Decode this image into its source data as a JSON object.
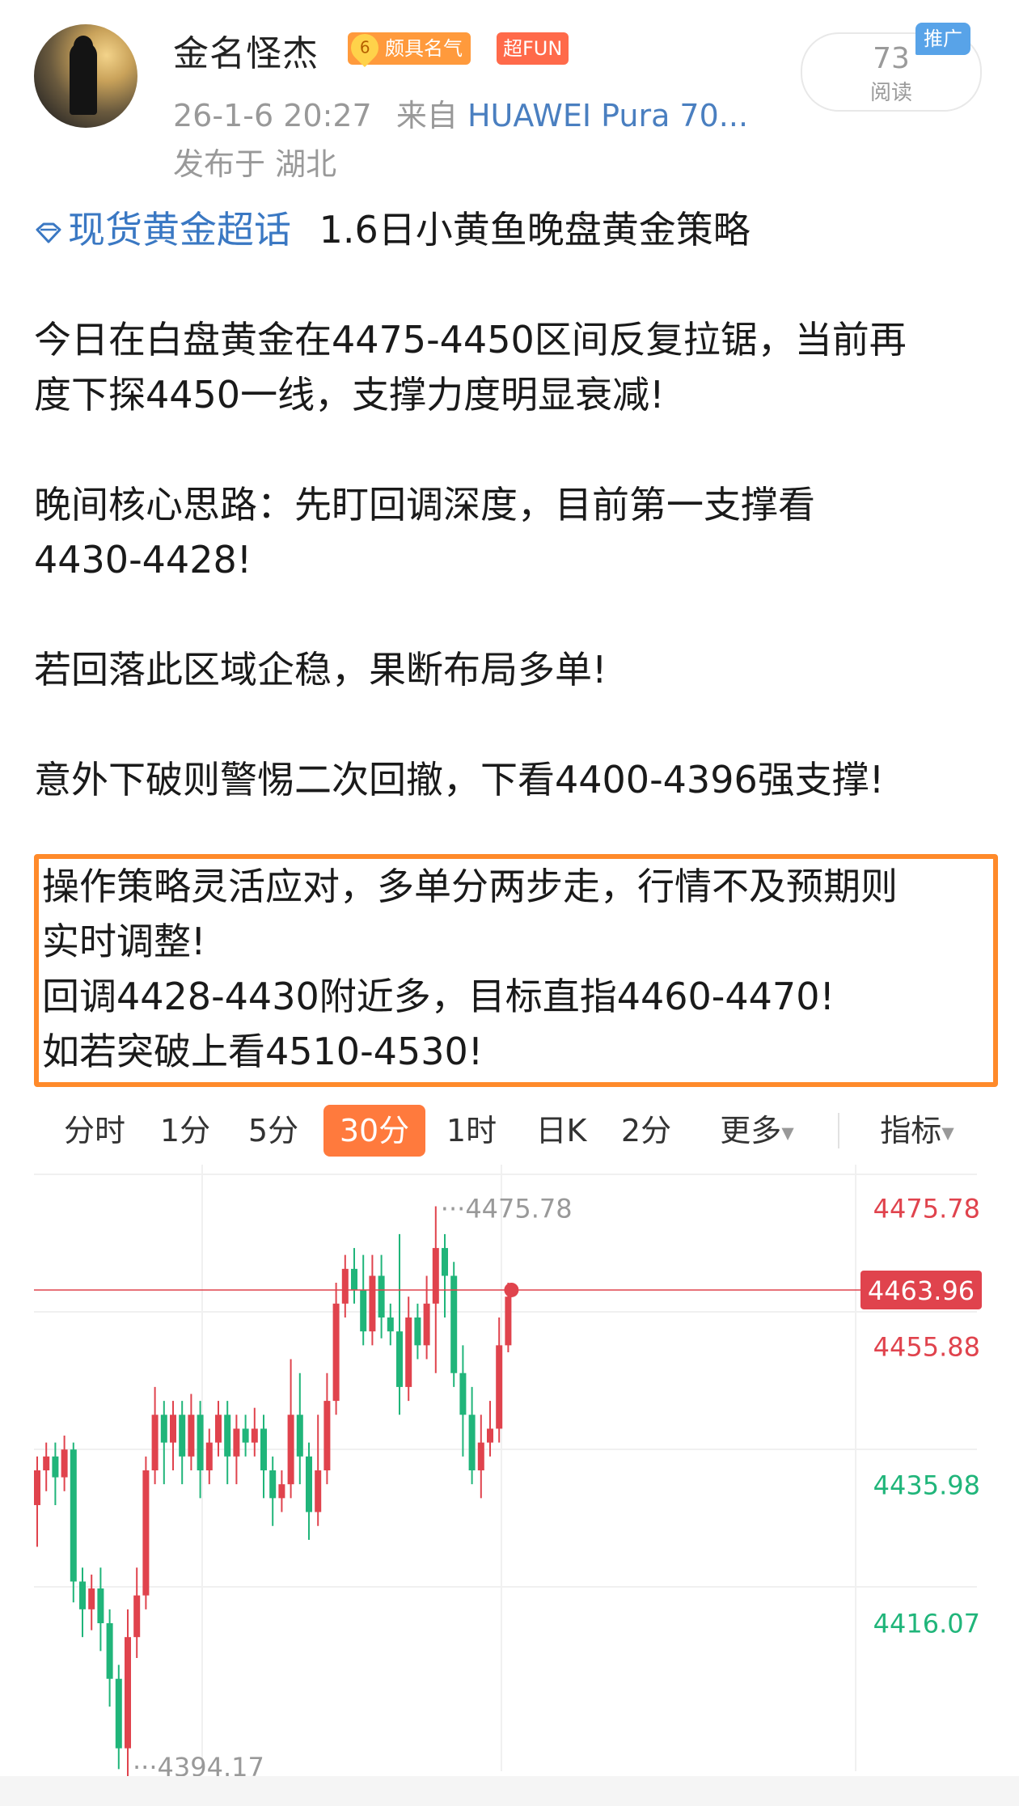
{
  "user": {
    "name": "金名怪杰",
    "reputation_level": "6",
    "reputation_badge": "颇具名气",
    "fun_badge": "超FUN",
    "timestamp": "26-1-6 20:27",
    "from_label": "来自",
    "device": "HUAWEI Pura 70...",
    "location": "发布于 湖北"
  },
  "reads": {
    "count": "73",
    "label": "阅读"
  },
  "promo_label": "推广",
  "post": {
    "topic": "现货黄金超话",
    "title": "1.6日小黄鱼晚盘黄金策略",
    "p1_line1": "今日在白盘黄金在4475-4450区间反复拉锯，当前再",
    "p1_line2": "度下探4450一线，支撑力度明显衰减!",
    "p2_line1": "晚间核心思路：先盯回调深度，目前第一支撑看",
    "p2_line2": "4430-4428!",
    "p3": "若回落此区域企稳，果断布局多单!",
    "p4": "意外下破则警惕二次回撤，下看4400-4396强支撑!",
    "hl_line1": "操作策略灵活应对，多单分两步走，行情不及预期则",
    "hl_line2": "实时调整!",
    "hl_line3": "回调4428-4430附近多，目标直指4460-4470!",
    "hl_line4": "如若突破上看4510-4530!"
  },
  "tabs": [
    {
      "label": "分时",
      "active": false
    },
    {
      "label": "1分",
      "active": false
    },
    {
      "label": "5分",
      "active": false
    },
    {
      "label": "30分",
      "active": true
    },
    {
      "label": "1时",
      "active": false
    },
    {
      "label": "日K",
      "active": false
    },
    {
      "label": "2分",
      "active": false
    },
    {
      "label": "更多",
      "active": false
    },
    {
      "label": "指标",
      "active": false
    }
  ],
  "colors": {
    "accent": "#ff7a3d",
    "highlight_border": "#ff8a2a",
    "up": "#e0434d",
    "down": "#20b57a",
    "topic": "#3a78c3"
  },
  "chart_data": {
    "type": "candlestick",
    "interval": "30分",
    "y_axis_labels": [
      "4475.78",
      "4455.88",
      "4435.98",
      "4416.07"
    ],
    "ylim": [
      4394,
      4482
    ],
    "current_price": "4463.96",
    "high_label": "4475.78",
    "low_label": "4394.17",
    "candles": [
      [
        4433,
        4438,
        4427,
        4440
      ],
      [
        4438,
        4440,
        4435,
        4442
      ],
      [
        4440,
        4437,
        4433,
        4442
      ],
      [
        4437,
        4441,
        4435,
        4443
      ],
      [
        4441,
        4422,
        4419,
        4442
      ],
      [
        4422,
        4418,
        4414,
        4424
      ],
      [
        4418,
        4421,
        4415,
        4423
      ],
      [
        4421,
        4416,
        4412,
        4424
      ],
      [
        4416,
        4408,
        4404,
        4418
      ],
      [
        4408,
        4398,
        4395,
        4410
      ],
      [
        4398,
        4414,
        4394,
        4418
      ],
      [
        4414,
        4420,
        4411,
        4424
      ],
      [
        4420,
        4438,
        4418,
        4440
      ],
      [
        4438,
        4446,
        4436,
        4450
      ],
      [
        4446,
        4442,
        4436,
        4448
      ],
      [
        4442,
        4446,
        4438,
        4448
      ],
      [
        4446,
        4440,
        4436,
        4448
      ],
      [
        4440,
        4446,
        4438,
        4449
      ],
      [
        4446,
        4438,
        4434,
        4448
      ],
      [
        4438,
        4442,
        4436,
        4444
      ],
      [
        4442,
        4446,
        4440,
        4448
      ],
      [
        4446,
        4440,
        4436,
        4448
      ],
      [
        4440,
        4444,
        4436,
        4446
      ],
      [
        4444,
        4442,
        4440,
        4446
      ],
      [
        4442,
        4444,
        4440,
        4447
      ],
      [
        4444,
        4438,
        4434,
        4446
      ],
      [
        4438,
        4434,
        4430,
        4440
      ],
      [
        4434,
        4436,
        4432,
        4438
      ],
      [
        4436,
        4446,
        4434,
        4454
      ],
      [
        4446,
        4440,
        4436,
        4452
      ],
      [
        4440,
        4432,
        4428,
        4442
      ],
      [
        4432,
        4438,
        4430,
        4446
      ],
      [
        4438,
        4448,
        4436,
        4452
      ],
      [
        4448,
        4462,
        4446,
        4465
      ],
      [
        4462,
        4467,
        4460,
        4469
      ],
      [
        4467,
        4464,
        4462,
        4470
      ],
      [
        4464,
        4458,
        4456,
        4469
      ],
      [
        4458,
        4466,
        4456,
        4469
      ],
      [
        4466,
        4460,
        4457,
        4469
      ],
      [
        4460,
        4458,
        4456,
        4462
      ],
      [
        4458,
        4450,
        4446,
        4472
      ],
      [
        4450,
        4460,
        4448,
        4463
      ],
      [
        4460,
        4456,
        4454,
        4462
      ],
      [
        4456,
        4462,
        4454,
        4466
      ],
      [
        4462,
        4470,
        4452,
        4476
      ],
      [
        4470,
        4466,
        4460,
        4472
      ],
      [
        4466,
        4452,
        4450,
        4468
      ],
      [
        4452,
        4446,
        4440,
        4456
      ],
      [
        4446,
        4438,
        4436,
        4450
      ],
      [
        4438,
        4442,
        4434,
        4446
      ],
      [
        4442,
        4444,
        4440,
        4448
      ],
      [
        4444,
        4456,
        4442,
        4460
      ],
      [
        4456,
        4463,
        4455,
        4465
      ]
    ]
  }
}
